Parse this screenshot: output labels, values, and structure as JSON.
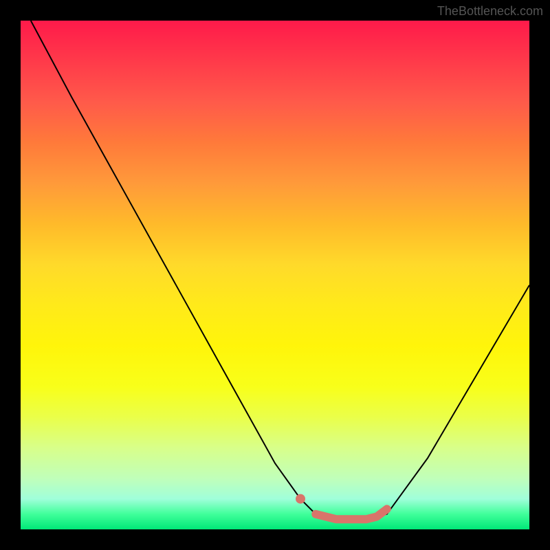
{
  "watermark": "TheBottleneck.com",
  "chart_data": {
    "type": "line",
    "title": "",
    "xlabel": "",
    "ylabel": "",
    "xlim": [
      0,
      100
    ],
    "ylim": [
      0,
      100
    ],
    "series": [
      {
        "name": "bottleneck-curve",
        "color": "#000000",
        "x": [
          2,
          10,
          20,
          30,
          40,
          50,
          55,
          58,
          62,
          68,
          72,
          80,
          90,
          100
        ],
        "y": [
          100,
          85,
          67,
          49,
          31,
          13,
          6,
          3,
          2,
          2,
          3,
          14,
          31,
          48
        ]
      },
      {
        "name": "optimal-range",
        "color": "#d9746a",
        "x": [
          55,
          58,
          62,
          68,
          70,
          72
        ],
        "y": [
          6,
          3,
          2,
          2,
          2.5,
          4
        ]
      }
    ]
  }
}
